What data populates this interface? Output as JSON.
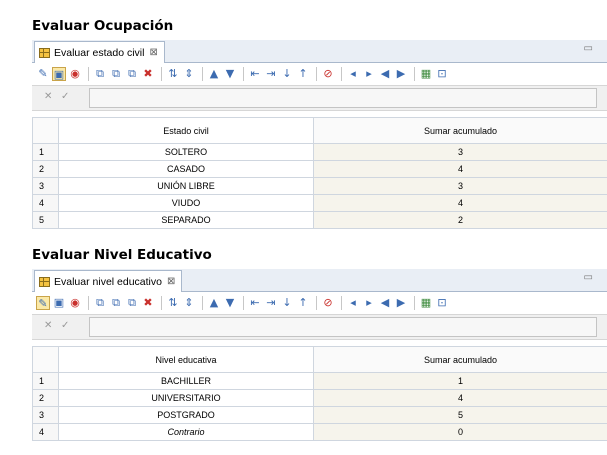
{
  "section1": {
    "title": "Evaluar Ocupación",
    "tab_label": "Evaluar estado civil",
    "tab_close": "⊠",
    "columns": [
      "Estado civil",
      "Sumar  acumulado"
    ],
    "rows": [
      {
        "n": "1",
        "label": "SOLTERO",
        "value": "3"
      },
      {
        "n": "2",
        "label": "CASADO",
        "value": "4"
      },
      {
        "n": "3",
        "label": "UNIÓN LIBRE",
        "value": "3"
      },
      {
        "n": "4",
        "label": "VIUDO",
        "value": "4"
      },
      {
        "n": "5",
        "label": "SEPARADO",
        "value": "2"
      }
    ]
  },
  "section2": {
    "title": "Evaluar Nivel Educativo",
    "tab_label": "Evaluar nivel educativo",
    "tab_close": "⊠",
    "columns": [
      "Nivel educativa",
      "Sumar  acumulado"
    ],
    "rows": [
      {
        "n": "1",
        "label": "BACHILLER",
        "value": "1"
      },
      {
        "n": "2",
        "label": "UNIVERSITARIO",
        "value": "4"
      },
      {
        "n": "3",
        "label": "POSTGRADO",
        "value": "5"
      },
      {
        "n": "4",
        "label": "Contrario",
        "value": "0"
      }
    ]
  },
  "formula_bar": {
    "cancel": "✕",
    "accept": "✓"
  },
  "icons": [
    "edit-icon",
    "copy-icon",
    "color-icon",
    "insert-rows-icon",
    "insert-cols-icon",
    "delete-icon",
    "sort-icon",
    "move-up-icon",
    "move-down-icon",
    "filter-icon",
    "clear-icon",
    "navigate-icon",
    "zoom-icon"
  ]
}
